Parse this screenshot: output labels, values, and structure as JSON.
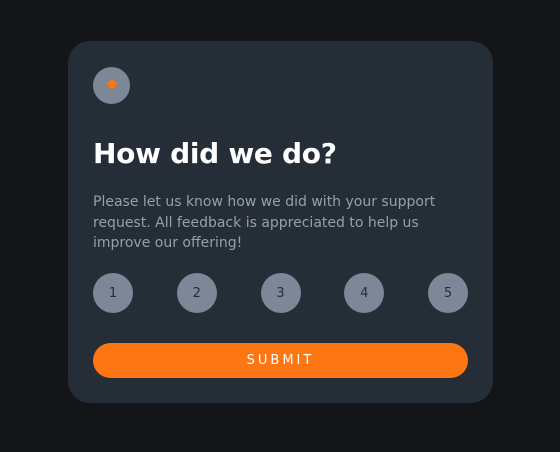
{
  "card": {
    "title": "How did we do?",
    "description": "Please let us know how we did with your support request. All feedback is appreciated to help us improve our offering!",
    "rating_options": [
      "1",
      "2",
      "3",
      "4",
      "5"
    ],
    "submit_label": "SUBMIT"
  },
  "icons": {
    "top": "star-icon"
  },
  "colors": {
    "page_background": "#131518",
    "card_background": "#252d37",
    "accent": "#fc7614",
    "rating_background": "#7c8798",
    "text_primary": "#ffffff",
    "text_secondary": "#969fad"
  }
}
